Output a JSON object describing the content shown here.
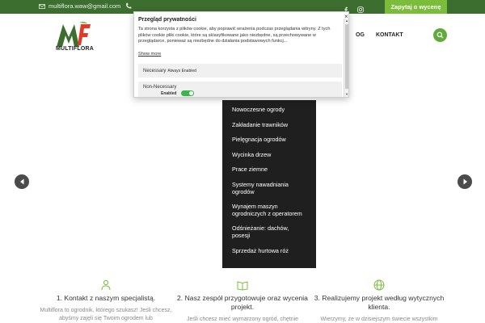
{
  "topbar": {
    "email": "multiflora.waw@gmail.com",
    "cta_label": "Zapytaj o wycenę",
    "icons": [
      "envelope-icon",
      "phone-icon",
      "facebook-icon",
      "instagram-icon"
    ]
  },
  "header": {
    "logo_text": "MULTIFLORA",
    "nav_partial": "OG",
    "nav_kontakt": "KONTAKT",
    "search_icon": "search-icon"
  },
  "dropdown": {
    "items": [
      "Nowoczesne ogrody",
      "Zakładanie trawników",
      "Pielęgnacja ogrodów",
      "Wycinka drzew",
      "Prace ziemne",
      "Systemy nawadniania ogrodów",
      "Wynajem maszyn ogrodniczych z operatorem",
      "Odśnieżanie: dachów, posesji",
      "Sprzedaż hurtowa róż"
    ]
  },
  "steps": [
    {
      "icon": "person-icon",
      "title": "1. Kontakt z naszym specjalistą.",
      "text": "Multiflora to ogrodnik, którego szukasz! Jeśli chcesz, abyśmy zajęli się Twoim ogrodem lub"
    },
    {
      "icon": "book-icon",
      "title": "2. Nasz zespół przygotowuje oraz wycenia projekt.",
      "text": "Jeśli chcesz mieć wymarzony ogród, chętnie"
    },
    {
      "icon": "globe-icon",
      "title": "3. Realizujemy projekt według wytycznych klienta.",
      "text": "Wierzymy, że w dzisiejszym świecie wszystkim"
    }
  ],
  "cookie": {
    "title": "Przegląd prywatności",
    "body": "Ta strona korzysta z plików cookie, aby poprawić wrażenia podczas przeglądania witryny. Z tych plików cookie pliki cookie, które są sklasyfikowane jako niezbędne, są przechowywane w przeglądarce, ponieważ są niezbędne do działania podstawowych funkcj...",
    "show_more": "Show more",
    "necessary_label": "Necessary",
    "always_enabled": "Always Enabled",
    "non_necessary_label": "Non-Necessary",
    "enabled_label": "Enabled",
    "close": "×",
    "non_necessary_enabled": true
  },
  "colors": {
    "topbar": "#3c6e2f",
    "cta": "#7bbd3b",
    "accent": "#64a93c",
    "dropdown_bg": "#1f1f1f"
  }
}
